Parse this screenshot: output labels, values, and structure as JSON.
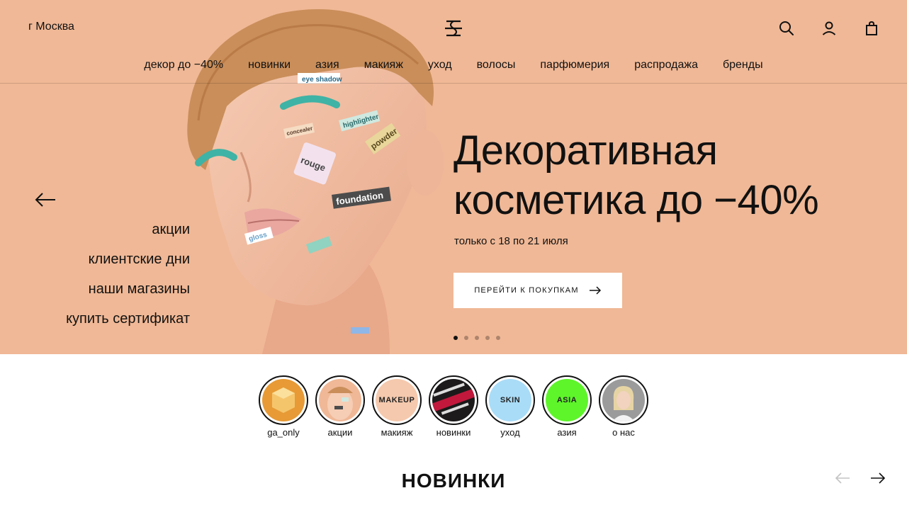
{
  "header": {
    "city": "г Москва",
    "icons": [
      "logo-icon",
      "search-icon",
      "account-icon",
      "bag-icon"
    ]
  },
  "nav": {
    "items": [
      {
        "label": "декор до −40%"
      },
      {
        "label": "новинки"
      },
      {
        "label": "азия"
      },
      {
        "label": "макияж"
      },
      {
        "label": "уход"
      },
      {
        "label": "волосы"
      },
      {
        "label": "парфюмерия"
      },
      {
        "label": "распродажа"
      },
      {
        "label": "бренды"
      }
    ]
  },
  "hero": {
    "title_line1": "Декоративная",
    "title_line2": "косметика до −40%",
    "subtitle": "только с 18 по 21 июля",
    "cta_label": "ПЕРЕЙТИ К ПОКУПКАМ",
    "background_color": "#f0b896",
    "slides_total": 5,
    "active_slide": 1,
    "sticker_labels": [
      "eye shadow",
      "highlighter",
      "concealer",
      "rouge",
      "powder",
      "foundation",
      "gloss"
    ]
  },
  "side_links": [
    {
      "label": "акции"
    },
    {
      "label": "клиентские дни"
    },
    {
      "label": "наши магазины"
    },
    {
      "label": "купить сертификат"
    }
  ],
  "stories": [
    {
      "label": "ga_only",
      "inner_text": ""
    },
    {
      "label": "акции",
      "inner_text": ""
    },
    {
      "label": "макияж",
      "inner_text": "MAKEUP",
      "color": "#f5c9ad"
    },
    {
      "label": "новинки",
      "inner_text": ""
    },
    {
      "label": "уход",
      "inner_text": "SKIN",
      "color": "#a9dcf7"
    },
    {
      "label": "азия",
      "inner_text": "ASIA",
      "color": "#5ef52a"
    },
    {
      "label": "о нас",
      "inner_text": ""
    }
  ],
  "section": {
    "title": "НОВИНКИ"
  }
}
